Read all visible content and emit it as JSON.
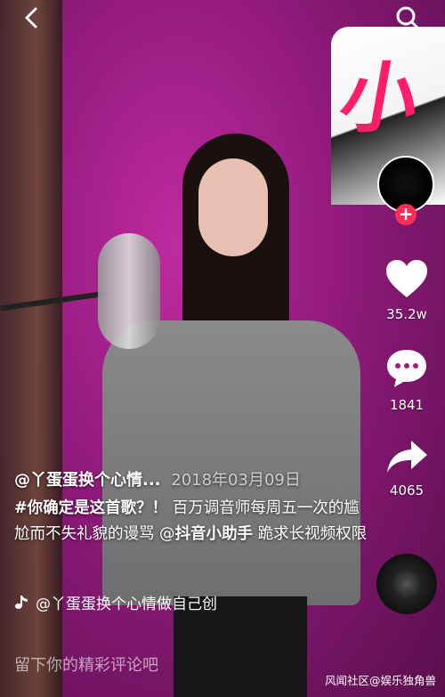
{
  "rail": {
    "likes": "35.2w",
    "comments": "1841",
    "shares": "4065"
  },
  "caption": {
    "author": "@丫蛋蛋换个心情...",
    "date": "2018年03月09日",
    "hashtag": "#你确定是这首歌？！",
    "desc_part1": " 百万调音师每周五一次的尴尬而不失礼貌的谩骂 @",
    "mention": "抖音小助手",
    "desc_part2": " 跪求长视频权限"
  },
  "music": "@丫蛋蛋换个心情做自己创",
  "comment_placeholder": "留下你的精彩评论吧",
  "watermark": "风闻社区@娱乐独角兽",
  "colors": {
    "accent": "#ff2d55",
    "wall": "#b0238f"
  },
  "icons": [
    "back-icon",
    "search-icon",
    "heart-icon",
    "comment-icon",
    "share-icon",
    "music-note-icon",
    "plus-icon"
  ]
}
